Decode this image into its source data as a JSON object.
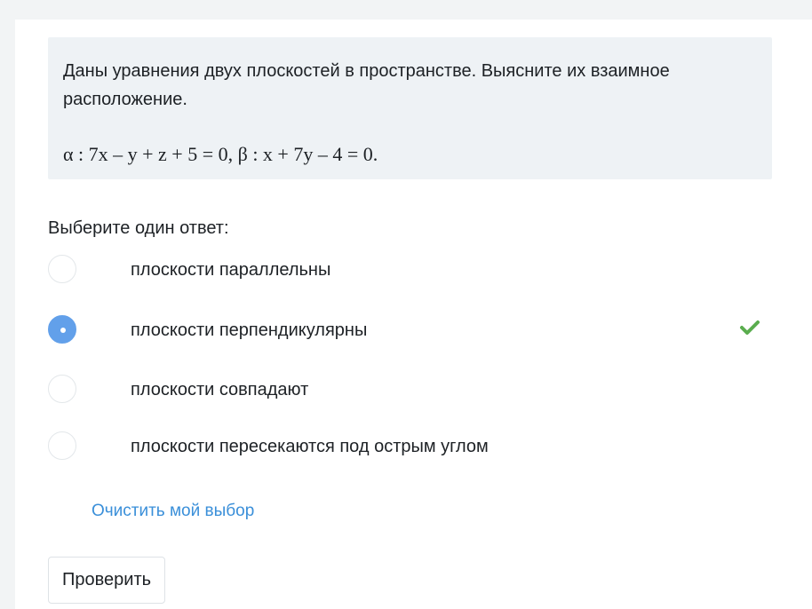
{
  "question": {
    "text": "Даны уравнения двух плоскостей в пространстве. Выясните их взаимное расположение.",
    "formula": "α : 7x – y + z + 5 = 0, β : x + 7y – 4 = 0."
  },
  "prompt": "Выберите один ответ:",
  "answers": [
    {
      "label": "плоскости параллельны",
      "selected": false,
      "correct": false
    },
    {
      "label": "плоскости перпендикулярны",
      "selected": true,
      "correct": true
    },
    {
      "label": "плоскости совпадают",
      "selected": false,
      "correct": false
    },
    {
      "label": "плоскости пересекаются под острым углом",
      "selected": false,
      "correct": false
    }
  ],
  "clear_choice_label": "Очистить мой выбор",
  "check_button_label": "Проверить",
  "colors": {
    "radio_selected": "#62a0ea",
    "correct_check": "#5aad4e",
    "link": "#3a8fd9"
  },
  "icons": {
    "correct": "check-icon"
  }
}
